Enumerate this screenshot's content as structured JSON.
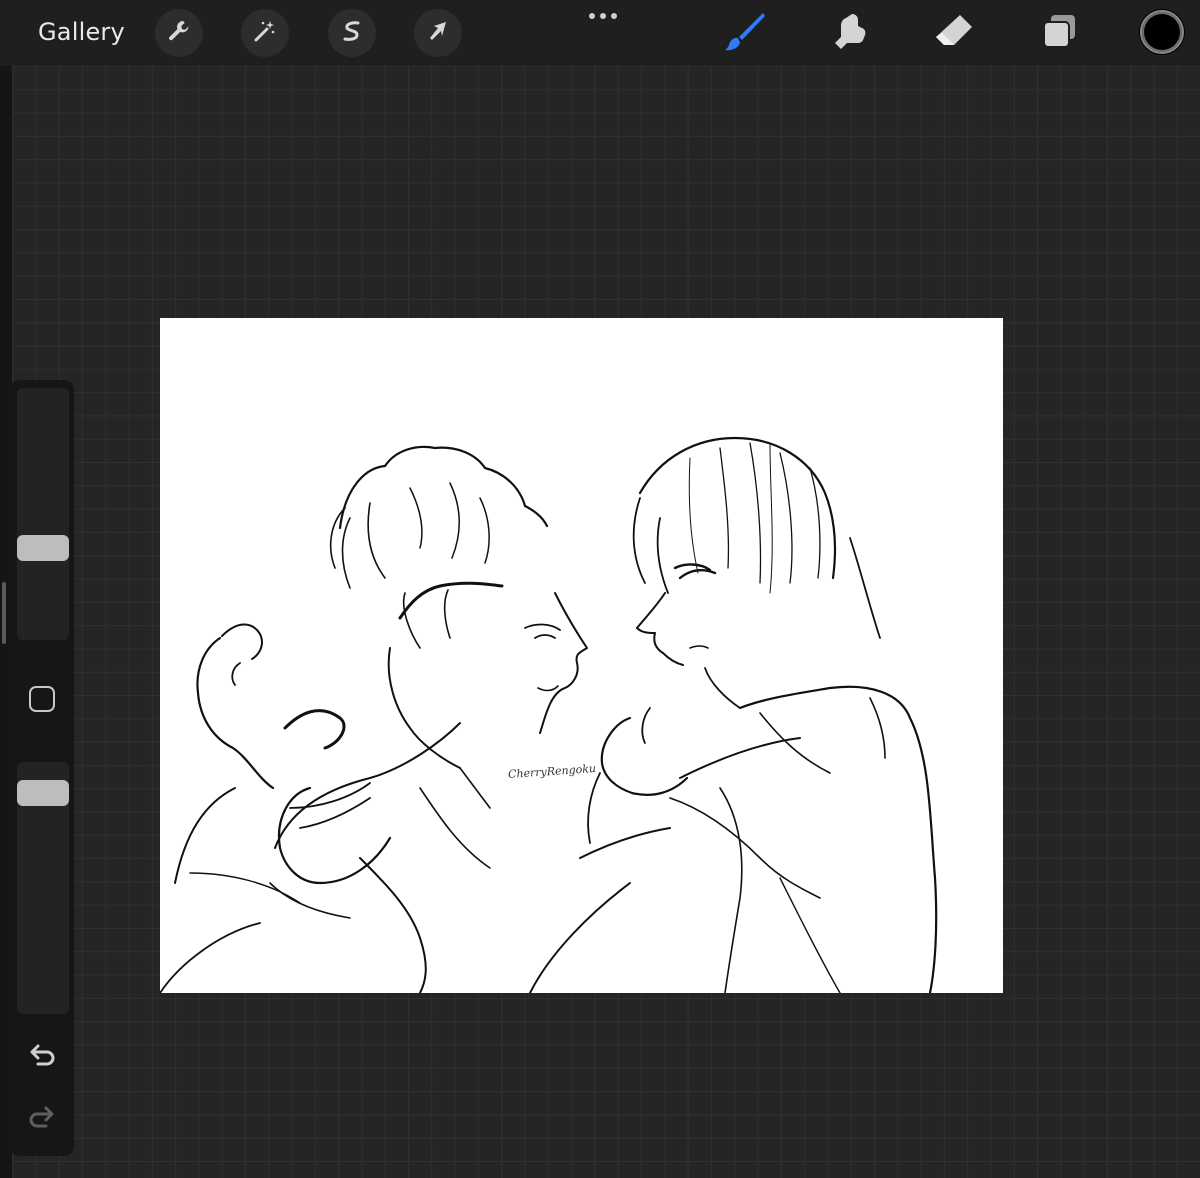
{
  "topbar": {
    "gallery_label": "Gallery",
    "actions": [
      {
        "name": "adjustments",
        "icon": "wrench-icon"
      },
      {
        "name": "magic",
        "icon": "magic-wand-icon"
      },
      {
        "name": "selection",
        "icon": "selection-icon"
      },
      {
        "name": "transform",
        "icon": "arrow-cursor-icon"
      }
    ],
    "tools": [
      {
        "name": "brush",
        "icon": "brush-icon",
        "active": true
      },
      {
        "name": "smudge",
        "icon": "smudge-icon",
        "active": false
      },
      {
        "name": "eraser",
        "icon": "eraser-icon",
        "active": false
      },
      {
        "name": "layers",
        "icon": "layers-icon",
        "active": false
      }
    ],
    "current_color": "#000000",
    "active_tool_color": "#2f7cf6"
  },
  "sidebar": {
    "brush_size_level": 0.35,
    "opacity_level": 0.92,
    "buttons": [
      {
        "name": "modify",
        "icon": "square-icon"
      },
      {
        "name": "undo",
        "icon": "undo-icon"
      },
      {
        "name": "redo",
        "icon": "redo-icon"
      }
    ]
  },
  "canvas": {
    "background": "#ffffff",
    "signature": "CherryRengoku"
  }
}
